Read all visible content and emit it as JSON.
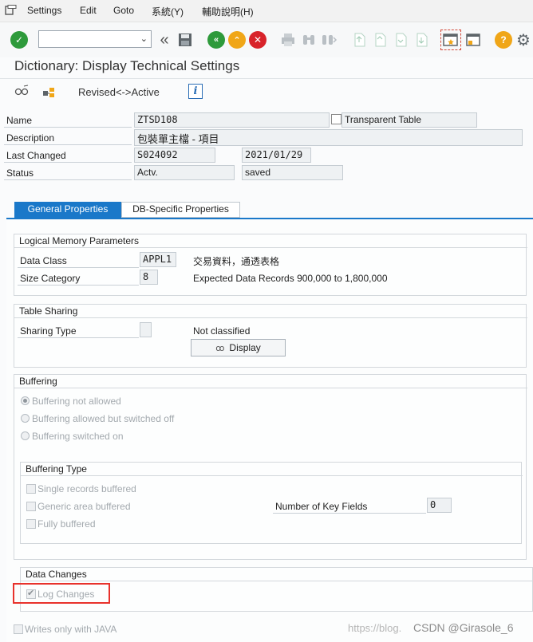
{
  "menu": {
    "items": [
      "Settings",
      "Edit",
      "Goto",
      "系統(Y)",
      "輔助說明(H)"
    ]
  },
  "toolbar": {
    "command_value": "",
    "icons": [
      "enter-check-icon",
      "double-chevron-left-icon",
      "save-icon",
      "back-icon",
      "exit-icon",
      "cancel-icon",
      "print-icon",
      "find-icon",
      "find-next-icon",
      "first-page-icon",
      "previous-page-icon",
      "next-page-icon",
      "last-page-icon",
      "create-session-icon",
      "shortcut-icon",
      "help-icon",
      "settings-gear-icon"
    ]
  },
  "title": "Dictionary: Display Technical Settings",
  "app_toolbar": {
    "revised_active": "Revised<->Active",
    "info_glyph": "i"
  },
  "header": {
    "name_label": "Name",
    "name_value": "ZTSD108",
    "table_type": "Transparent Table",
    "description_label": "Description",
    "description_value": "包裝單主檔 - 項目",
    "last_changed_label": "Last Changed",
    "last_changed_user": "S024092",
    "last_changed_date": "2021/01/29",
    "status_label": "Status",
    "status_value": "Actv.",
    "status_saved": "saved"
  },
  "tabs": {
    "general": "General Properties",
    "db_specific": "DB-Specific Properties"
  },
  "logical_memory": {
    "title": "Logical Memory Parameters",
    "data_class_label": "Data Class",
    "data_class_value": "APPL1",
    "data_class_desc": "交易資料，通透表格",
    "size_category_label": "Size Category",
    "size_category_value": "8",
    "size_category_desc": "Expected Data Records 900,000 to 1,800,000"
  },
  "table_sharing": {
    "title": "Table Sharing",
    "sharing_type_label": "Sharing Type",
    "sharing_type_value": "",
    "sharing_desc": "Not classified",
    "display_button": "Display"
  },
  "buffering": {
    "title": "Buffering",
    "options": [
      "Buffering not allowed",
      "Buffering allowed but switched off",
      "Buffering switched on"
    ],
    "selected": 0
  },
  "buffering_type": {
    "title": "Buffering Type",
    "single": "Single records buffered",
    "generic": "Generic area buffered",
    "fully": "Fully buffered",
    "key_fields_label": "Number of Key Fields",
    "key_fields_value": "0"
  },
  "data_changes": {
    "title": "Data Changes",
    "log_changes": "Log Changes",
    "log_changes_checked": true
  },
  "writes_java": "Writes only with JAVA",
  "watermark": "https://blog.",
  "csdn": "CSDN @Girasole_6"
}
